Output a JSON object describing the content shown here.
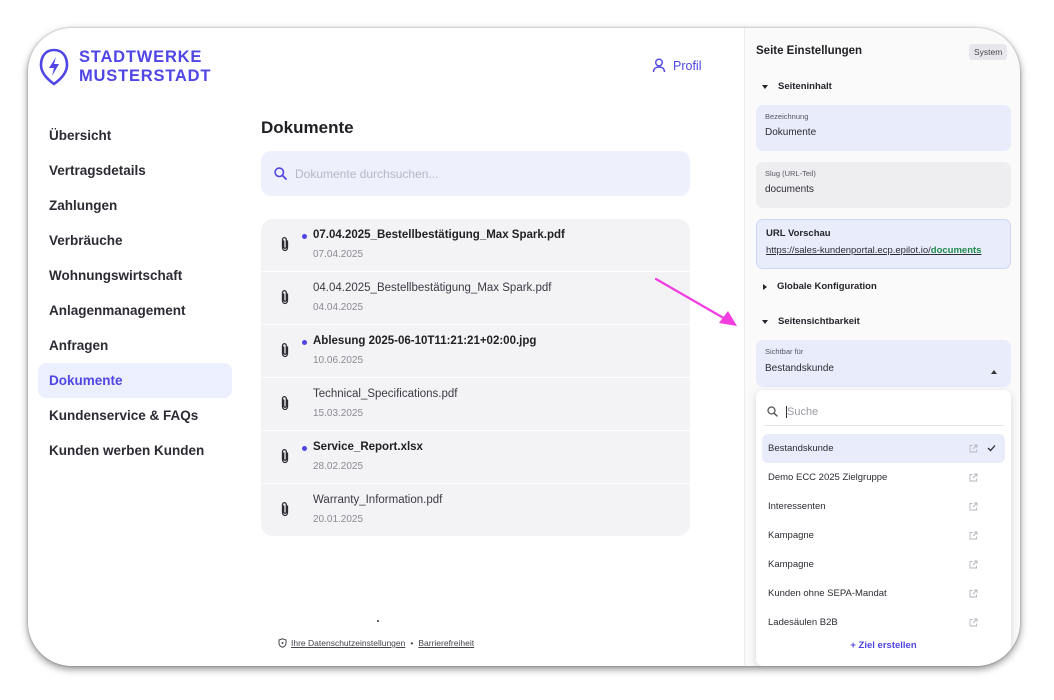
{
  "brand": {
    "line1": "STADTWERKE",
    "line2": "MUSTERSTADT",
    "color": "#4f46e5"
  },
  "header": {
    "profile_label": "Profil"
  },
  "nav": {
    "items": [
      {
        "label": "Übersicht"
      },
      {
        "label": "Vertragsdetails"
      },
      {
        "label": "Zahlungen"
      },
      {
        "label": "Verbräuche"
      },
      {
        "label": "Wohnungswirtschaft"
      },
      {
        "label": "Anlagenmanagement"
      },
      {
        "label": "Anfragen"
      },
      {
        "label": "Dokumente",
        "active": true
      },
      {
        "label": "Kundenservice & FAQs"
      },
      {
        "label": "Kunden werben Kunden"
      }
    ]
  },
  "main": {
    "title": "Dokumente",
    "search_placeholder": "Dokumente durchsuchen...",
    "documents": [
      {
        "name": "07.04.2025_Bestellbestätigung_Max Spark.pdf",
        "date": "07.04.2025",
        "unread": true
      },
      {
        "name": "04.04.2025_Bestellbestätigung_Max Spark.pdf",
        "date": "04.04.2025",
        "unread": false
      },
      {
        "name": "Ablesung 2025-06-10T11:21:21+02:00.jpg",
        "date": "10.06.2025",
        "unread": true
      },
      {
        "name": "Technical_Specifications.pdf",
        "date": "15.03.2025",
        "unread": false
      },
      {
        "name": "Service_Report.xlsx",
        "date": "28.02.2025",
        "unread": true
      },
      {
        "name": "Warranty_Information.pdf",
        "date": "20.01.2025",
        "unread": false
      }
    ]
  },
  "footer": {
    "privacy_label": "Ihre Datenschutzeinstellungen",
    "separator": "•",
    "accessibility_label": "Barrierefreiheit"
  },
  "panel": {
    "title": "Seite Einstellungen",
    "badge": "System",
    "section_content": "Seiteninhalt",
    "name_field": {
      "label": "Bezeichnung",
      "value": "Dokumente"
    },
    "slug_field": {
      "label": "Slug (URL-Teil)",
      "value": "documents"
    },
    "url_preview": {
      "title": "URL Vorschau",
      "base": "https://sales-kundenportal.ecp.epilot.io/",
      "slug": "documents"
    },
    "section_global": "Globale Konfiguration",
    "section_visibility": "Seitensichtbarkeit",
    "visible_for": {
      "label": "Sichtbar für",
      "value": "Bestandskunde"
    },
    "dropdown": {
      "search_placeholder": "Suche",
      "options": [
        {
          "label": "Bestandskunde",
          "selected": true
        },
        {
          "label": "Demo ECC 2025 Zielgruppe",
          "selected": false
        },
        {
          "label": "Interessenten",
          "selected": false
        },
        {
          "label": "Kampagne",
          "selected": false
        },
        {
          "label": "Kampagne",
          "selected": false
        },
        {
          "label": "Kunden ohne SEPA-Mandat",
          "selected": false
        },
        {
          "label": "Ladesäulen B2B",
          "selected": false
        }
      ],
      "create_label": "+ Ziel erstellen"
    }
  },
  "annotation": {
    "arrow_color": "#f23ee0"
  }
}
